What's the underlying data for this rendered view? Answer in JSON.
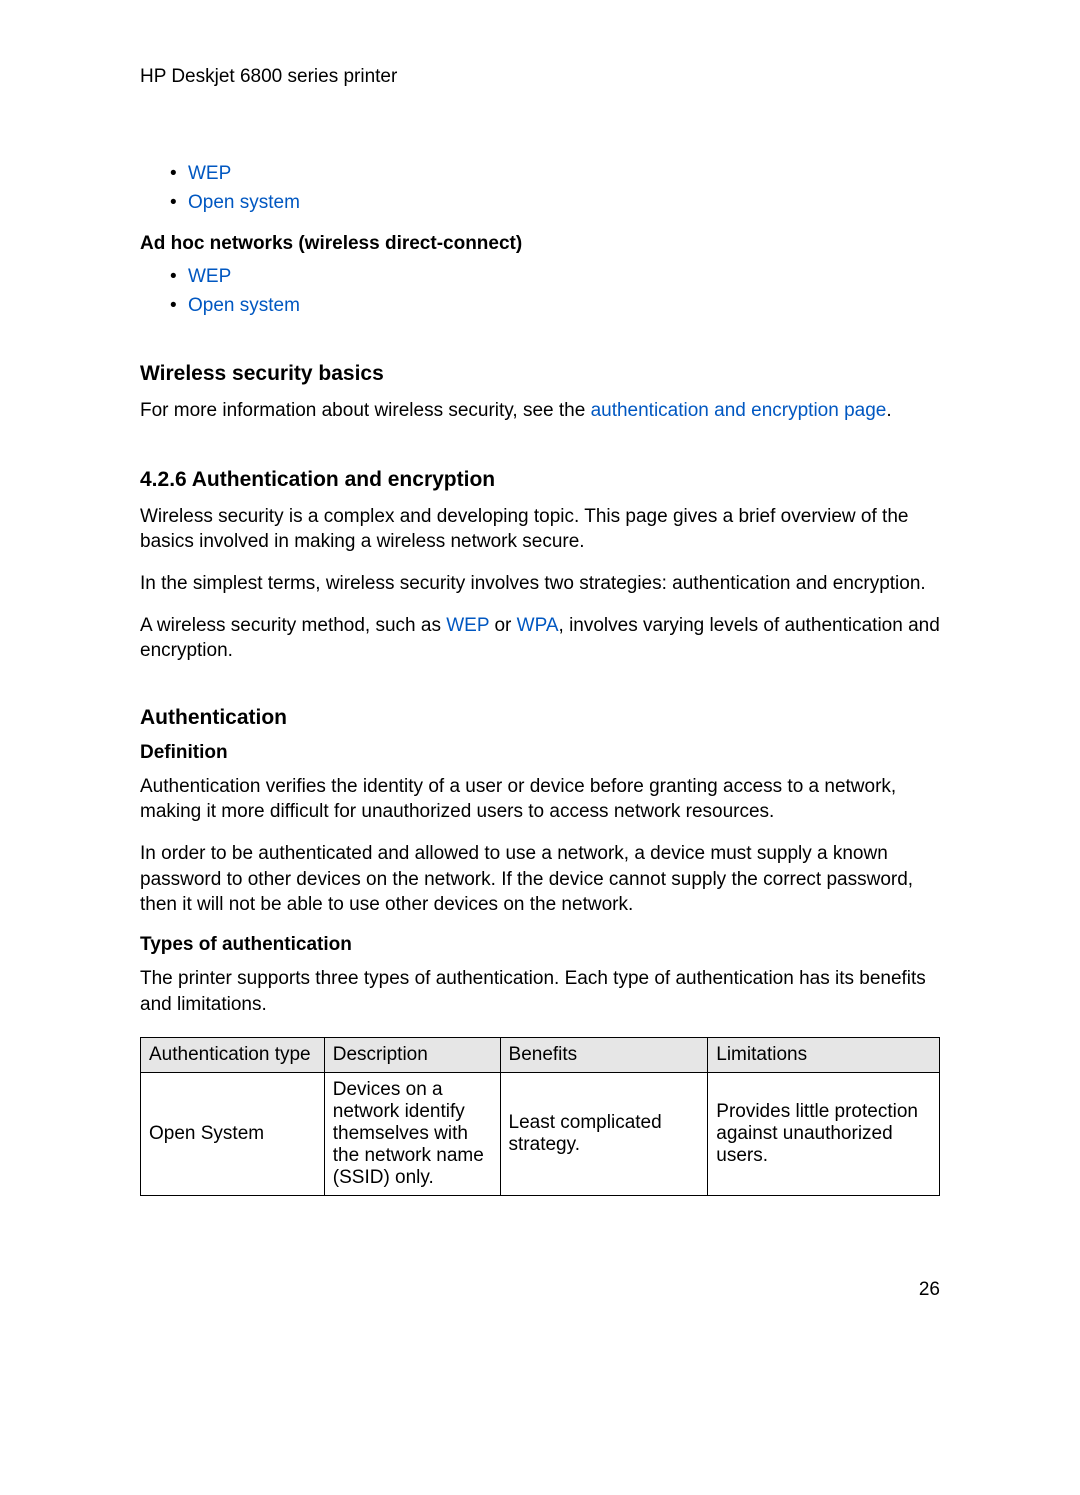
{
  "running_header": "HP Deskjet 6800 series printer",
  "top_list": {
    "items": [
      {
        "label": "WEP"
      },
      {
        "label": "Open system"
      }
    ]
  },
  "adhoc_heading": "Ad hoc networks (wireless direct-connect)",
  "adhoc_list": {
    "items": [
      {
        "label": "WEP"
      },
      {
        "label": "Open system"
      }
    ]
  },
  "wireless_basics": {
    "heading": "Wireless security basics",
    "text_pre": "For more information about wireless security, see the ",
    "link": "authentication and encryption page",
    "text_post": "."
  },
  "section_426": {
    "heading": "4.2.6  Authentication and encryption",
    "p1": "Wireless security is a complex and developing topic. This page gives a brief overview of the basics involved in making a wireless network secure.",
    "p2": "In the simplest terms, wireless security involves two strategies: authentication and encryption.",
    "p3_pre": "A wireless security method, such as ",
    "p3_link1": "WEP",
    "p3_mid": " or ",
    "p3_link2": "WPA",
    "p3_post": ", involves varying levels of authentication and encryption."
  },
  "authentication": {
    "heading": "Authentication",
    "definition_label": "Definition",
    "def_p1": "Authentication verifies the identity of a user or device before granting access to a network, making it more difficult for unauthorized users to access network resources.",
    "def_p2": "In order to be authenticated and allowed to use a network, a device must supply a known password to other devices on the network. If the device cannot supply the correct password, then it will not be able to use other devices on the network.",
    "types_label": "Types of authentication",
    "types_p": "The printer supports three types of authentication. Each type of authentication has its benefits and limitations."
  },
  "table": {
    "headers": {
      "type": "Authentication type",
      "description": "Description",
      "benefits": "Benefits",
      "limitations": "Limitations"
    },
    "rows": [
      {
        "type": "Open System",
        "description": "Devices on a network identify themselves with the network name (SSID) only.",
        "benefits": "Least complicated strategy.",
        "limitations": "Provides little protection against unauthorized users."
      }
    ]
  },
  "page_number": "26"
}
